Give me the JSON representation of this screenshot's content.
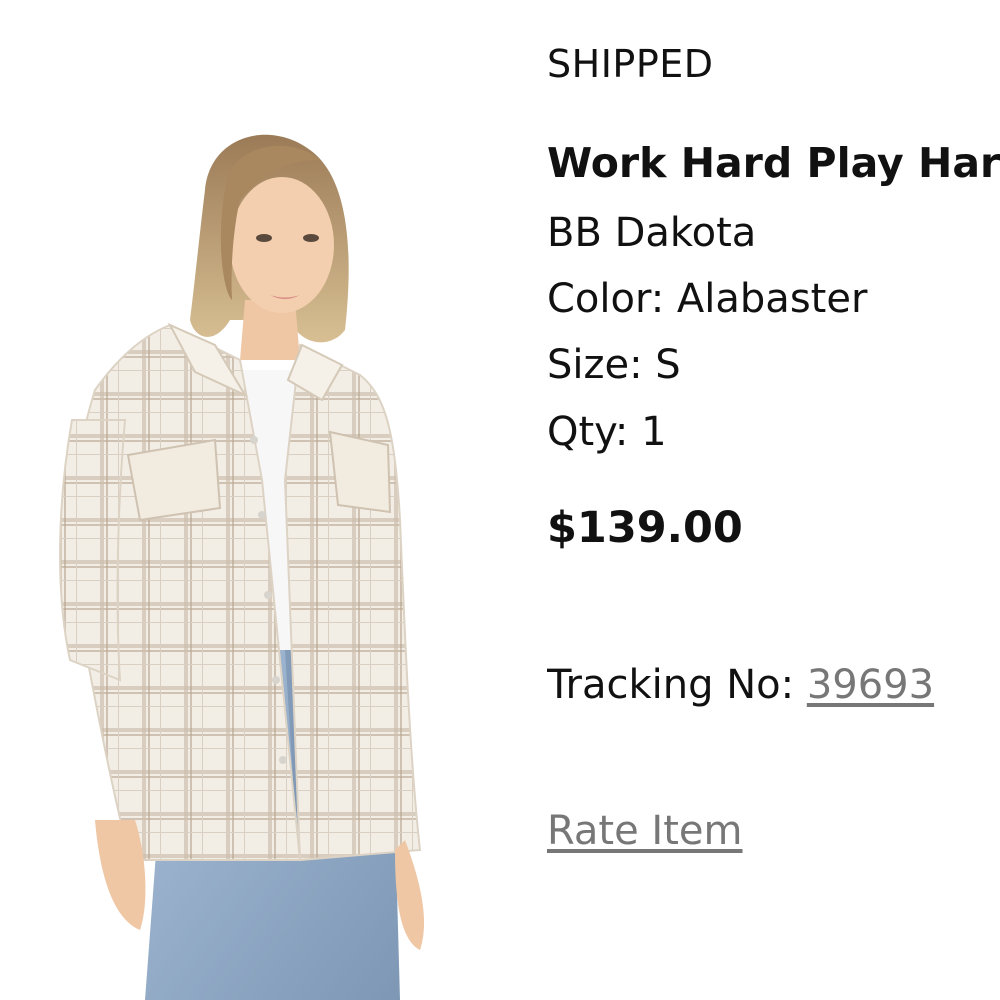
{
  "order_item": {
    "status": "SHIPPED",
    "name": "Work Hard Play Hard Jacket",
    "brand": "BB Dakota",
    "color": "Color: Alabaster",
    "size": "Size: S",
    "qty": "Qty: 1",
    "price": "$139.00",
    "tracking_label": "Tracking No: ",
    "tracking_number": "39693",
    "rate_label": "Rate Item"
  },
  "colors": {
    "text": "#111111",
    "link": "#777777",
    "jacket": "#f1ebe0",
    "plaid": "#b9a995",
    "denim": "#8fa9c6"
  }
}
